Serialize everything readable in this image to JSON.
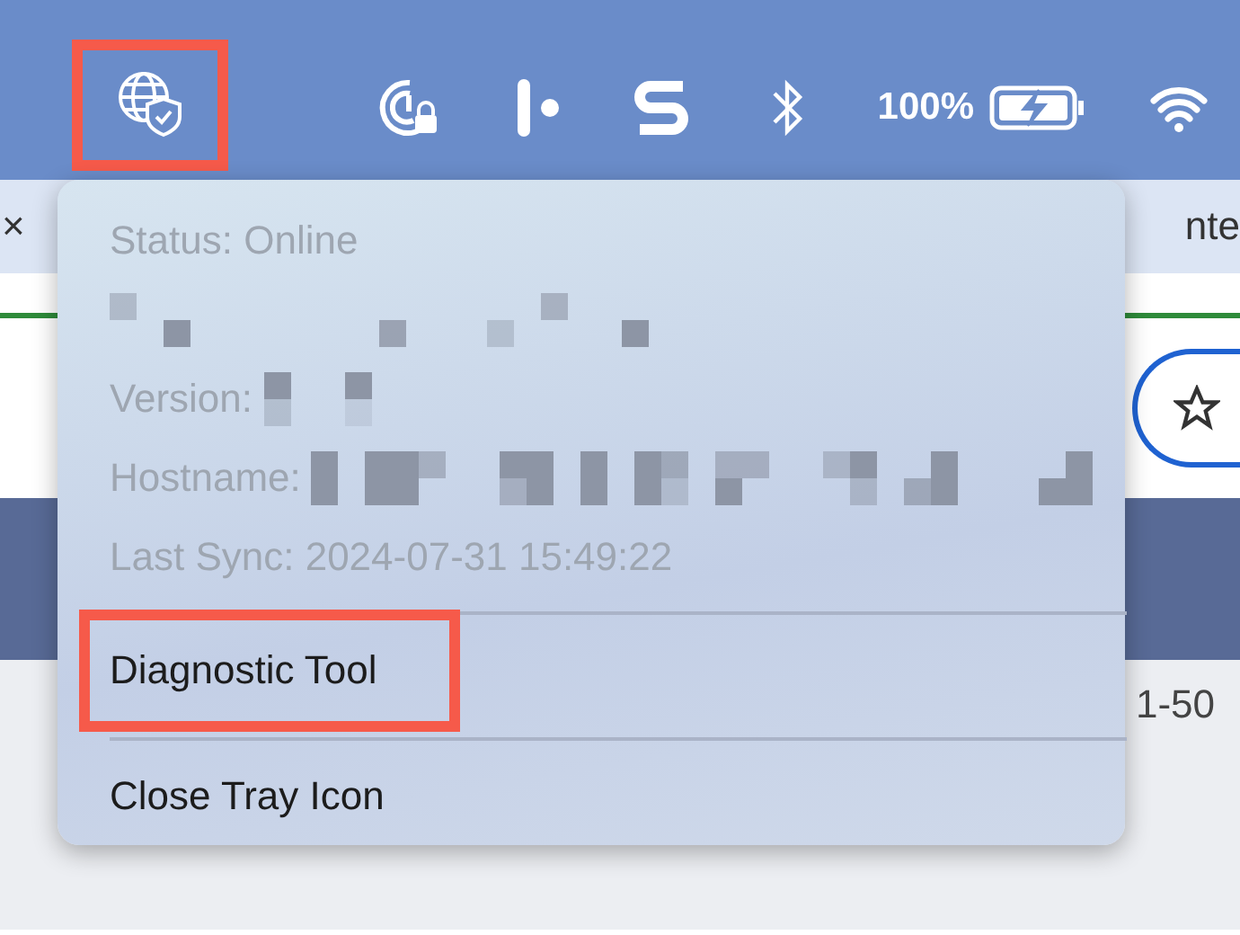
{
  "menu_bar": {
    "tray_icon": {
      "highlighted": true
    },
    "battery": {
      "percent": "100%"
    }
  },
  "browser": {
    "tab_close": "×",
    "tab_title": "nte",
    "page_range": "1-50"
  },
  "tray_menu": {
    "info": [
      {
        "kind": "text",
        "text": "Status: Online"
      },
      {
        "kind": "redacted"
      },
      {
        "kind": "labeled",
        "label": "Version:"
      },
      {
        "kind": "labeled",
        "label": "Hostname:"
      },
      {
        "kind": "text",
        "text": "Last Sync: 2024-07-31 15:49:22"
      }
    ],
    "actions": [
      {
        "label": "Diagnostic Tool",
        "highlighted": true
      },
      {
        "label": "Close Tray Icon",
        "highlighted": false
      }
    ]
  }
}
